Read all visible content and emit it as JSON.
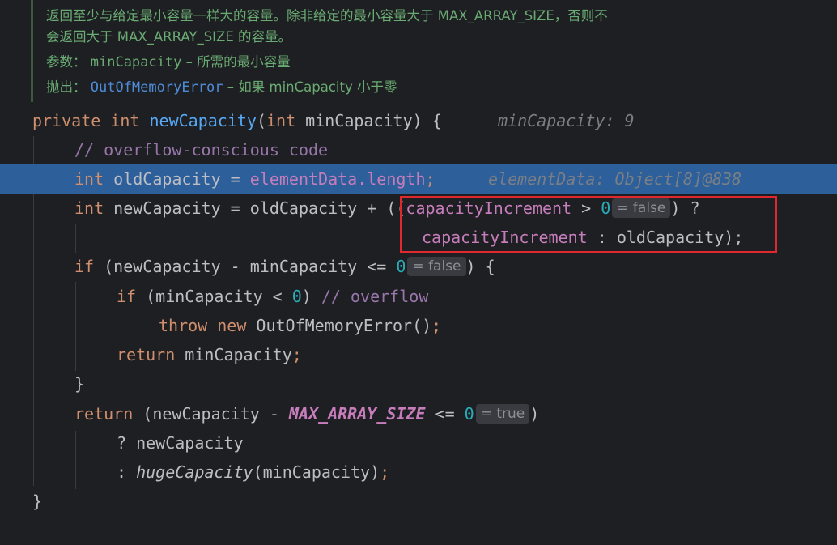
{
  "javadoc": {
    "desc_line1": "返回至少与给定最小容量一样大的容量。除非给定的最小容量大于 MAX_ARRAY_SIZE，否则不",
    "desc_line2": "会返回大于 MAX_ARRAY_SIZE 的容量。",
    "params_label": "参数：",
    "param_name": "minCapacity",
    "param_desc": " – 所需的最小容量",
    "throws_label": "抛出：",
    "throws_type": "OutOfMemoryError",
    "throws_desc": " – 如果 minCapacity 小于零"
  },
  "code": {
    "l1": {
      "kw_private": "private",
      "kw_int": "int",
      "method": "newCapacity",
      "open": "(",
      "param_type": "int",
      "param_rest": " minCapacity) {",
      "hint": "minCapacity: 9"
    },
    "l2": {
      "comment": "// overflow-conscious code"
    },
    "l3": {
      "kw_int": "int",
      "var": " oldCapacity = ",
      "field": "elementData",
      "dot_len": ".length",
      "semi": ";",
      "hint": "elementData: Object[8]@838"
    },
    "l4": {
      "kw_int": "int",
      "rest": " newCapacity = oldCapacity + ((",
      "field": "capacityIncrement",
      "cmp": " > ",
      "zero": "0",
      "inlay": "= false",
      "close": ") ?"
    },
    "l5": {
      "field": "capacityIncrement",
      "rest": " : oldCapacity);",
      "semi": ";"
    },
    "l6": {
      "kw_if": "if",
      "rest": " (newCapacity - minCapacity <= ",
      "zero": "0",
      "inlay": "= false",
      "close": ") {"
    },
    "l7": {
      "kw_if": "if",
      "rest": " (minCapacity < ",
      "zero": "0",
      "close": ") ",
      "comment_slash": "// ",
      "comment": "overflow"
    },
    "l8": {
      "kw_throw": "throw",
      "kw_new": "new",
      "rest": " OutOfMemoryError()",
      "semi": ";"
    },
    "l9": {
      "kw_return": "return",
      "rest": " minCapacity",
      "semi": ";"
    },
    "l10": {
      "brace": "}"
    },
    "l11": {
      "kw_return": "return",
      "rest": " (newCapacity - ",
      "const": "MAX_ARRAY_SIZE",
      "cmp": " <= ",
      "zero": "0",
      "inlay": "= true",
      "close": ")"
    },
    "l12": {
      "text": "? newCapacity"
    },
    "l13": {
      "colon": ": ",
      "method": "hugeCapacity",
      "rest": "(minCapacity)",
      "semi": ";"
    },
    "l14": {
      "brace": "}"
    }
  }
}
